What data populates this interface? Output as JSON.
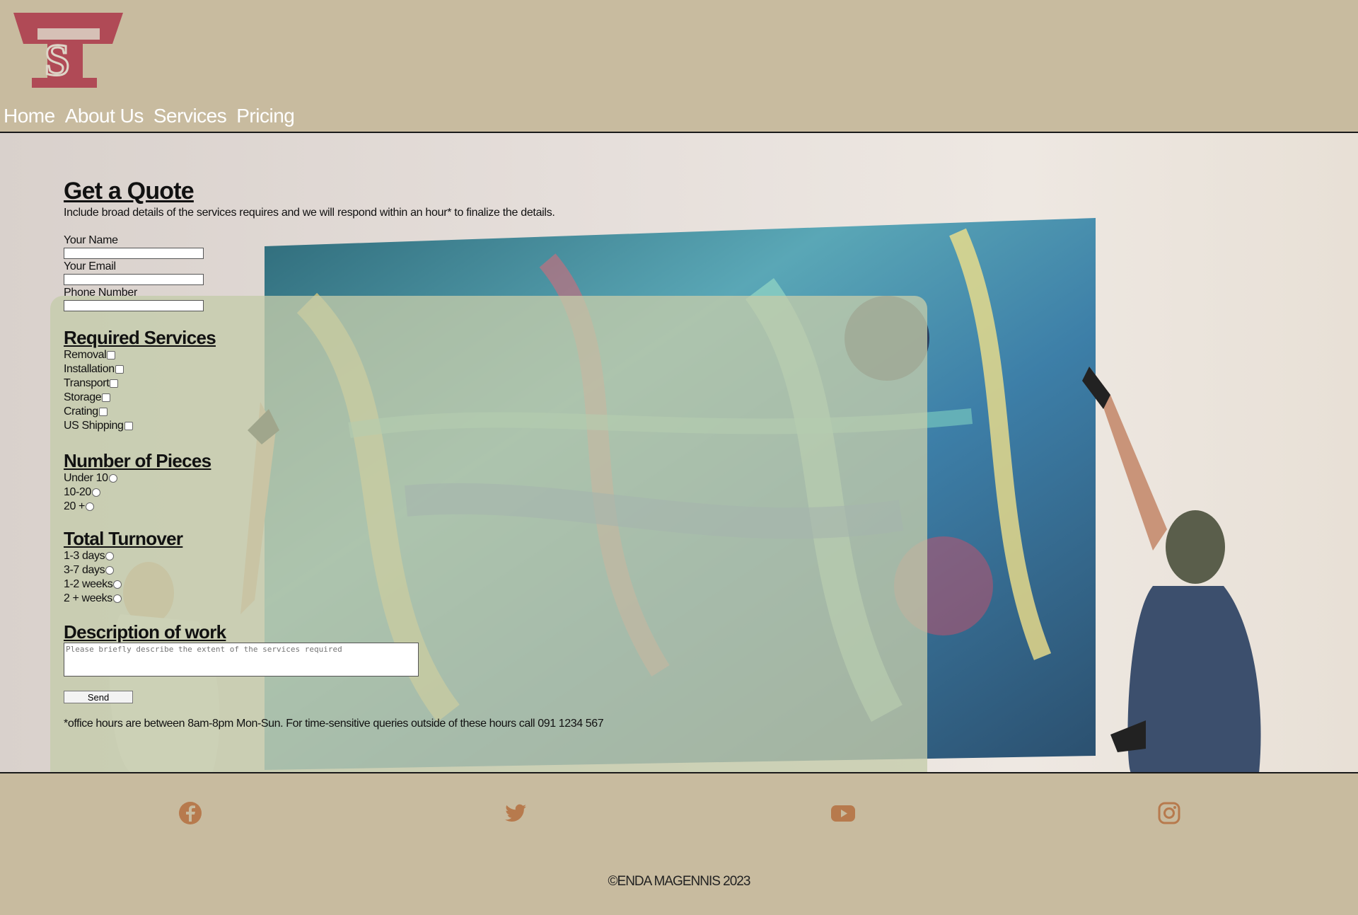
{
  "header": {
    "logo_alt": "TS",
    "nav": [
      "Home",
      "About Us",
      "Services",
      "Pricing"
    ]
  },
  "form": {
    "title": "Get a Quote",
    "lead": "Include broad details of the services requires and we will respond within an hour* to finalize the details.",
    "fields": {
      "name_label": "Your Name",
      "email_label": "Your Email",
      "phone_label": "Phone Number"
    },
    "services": {
      "heading": "Required Services",
      "options": [
        "Removal",
        "Installation",
        "Transport",
        "Storage",
        "Crating",
        "US Shipping"
      ]
    },
    "pieces": {
      "heading": "Number of Pieces",
      "options": [
        "Under 10",
        "10-20",
        "20 +"
      ]
    },
    "turnover": {
      "heading": "Total Turnover",
      "options": [
        "1-3 days",
        "3-7 days",
        "1-2 weeks",
        "2 + weeks"
      ]
    },
    "description": {
      "heading": "Description of work",
      "placeholder": "Please briefly describe the extent of the services required"
    },
    "send_label": "Send",
    "note": "*office hours are between 8am-8pm Mon-Sun. For time-sensitive queries outside of these hours call 091 1234 567"
  },
  "footer": {
    "social": [
      "facebook-icon",
      "twitter-icon",
      "youtube-icon",
      "instagram-icon"
    ],
    "copyright": "©ENDA MAGENNIS 2023",
    "icon_color": "#b77a4d"
  },
  "colors": {
    "page_bg": "#c8bb9f",
    "nav_text": "#ffffff",
    "logo_red": "#b04a56"
  }
}
